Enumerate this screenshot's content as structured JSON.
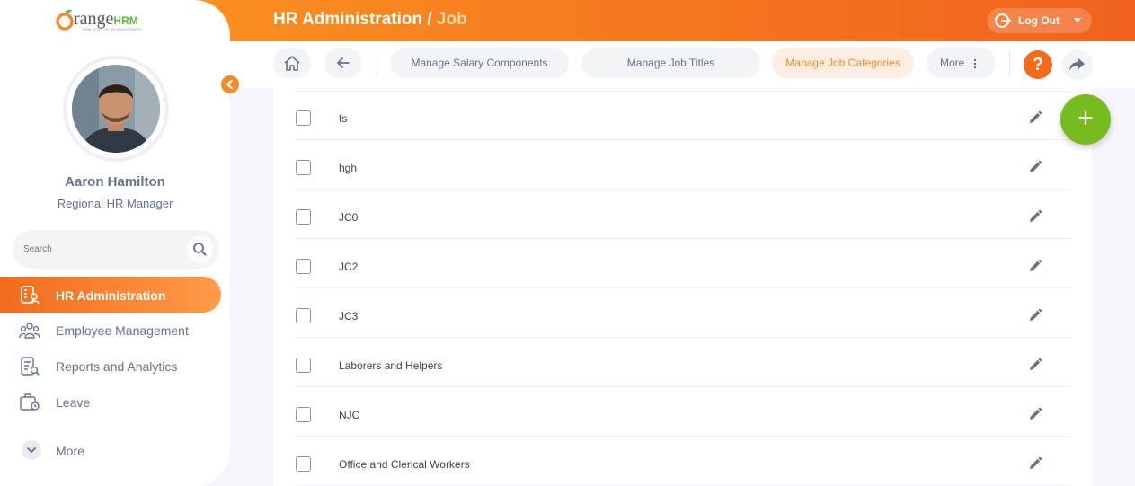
{
  "app": {
    "logo_text_orange": "Orange",
    "logo_text_hrm": "HRM",
    "logo_tagline": "NEW LEVEL OF HR MANAGEMENT"
  },
  "header": {
    "title": "HR Administration /",
    "subtitle": "Job",
    "logout_label": "Log Out"
  },
  "user": {
    "name": "Aaron Hamilton",
    "role": "Regional HR Manager"
  },
  "search": {
    "placeholder": "Search"
  },
  "sidebar": {
    "items": [
      {
        "label": "HR Administration",
        "icon": "hr-admin-icon",
        "active": true
      },
      {
        "label": "Employee Management",
        "icon": "employees-icon",
        "active": false
      },
      {
        "label": "Reports and Analytics",
        "icon": "reports-icon",
        "active": false
      },
      {
        "label": "Leave",
        "icon": "leave-icon",
        "active": false
      }
    ],
    "more_label": "More"
  },
  "toolbar": {
    "tabs": [
      {
        "label": "Manage Salary Components",
        "active": false
      },
      {
        "label": "Manage Job Titles",
        "active": false
      },
      {
        "label": "Manage Job Categories",
        "active": true
      },
      {
        "label": "More",
        "active": false
      }
    ],
    "help_label": "?"
  },
  "rows": [
    {
      "name": "fs"
    },
    {
      "name": "hgh"
    },
    {
      "name": "JC0"
    },
    {
      "name": "JC2"
    },
    {
      "name": "JC3"
    },
    {
      "name": "Laborers and Helpers"
    },
    {
      "name": "NJC"
    },
    {
      "name": "Office and Clerical Workers"
    }
  ],
  "fab_label": "+",
  "colors": {
    "brand_orange": "#f28c28",
    "active_green": "#76bc21",
    "text_gray": "#64728c"
  }
}
